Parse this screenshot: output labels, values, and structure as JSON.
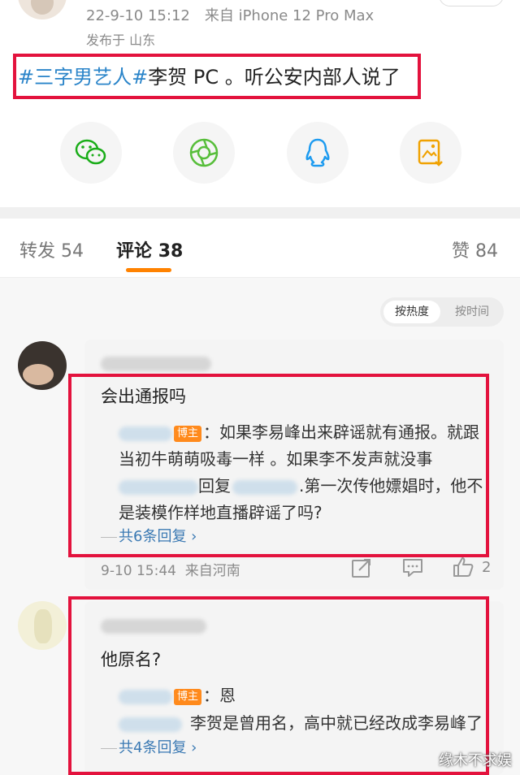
{
  "post": {
    "date": "22-9-10 15:12",
    "device": "来自 iPhone 12 Pro Max",
    "location": "发布于 山东",
    "text_tag": "#三字男艺人#",
    "text_body": "李贺 PC 。听公安内部人说了"
  },
  "share_icons": [
    "wechat-icon",
    "moments-icon",
    "qq-icon",
    "save-image-icon"
  ],
  "tabs": {
    "repost": "转发 54",
    "comments_label": "评论",
    "comments_count": "38",
    "likes": "赞 84"
  },
  "sort": {
    "hot": "按热度",
    "time": "按时间"
  },
  "comments": [
    {
      "text": "会出通报吗",
      "badge": "博主",
      "reply1_a": "：如果李易峰出来辟谣就有通报。就跟",
      "reply1_b": "当初牛萌萌吸毒一样 。如果李不发声就没事",
      "reply2_mid": "回复",
      "reply2_a": ".第一次传他嫖娼时，他不",
      "reply2_b": "是装模作样地直播辟谣了吗?",
      "more": "共6条回复 ›",
      "time": "9-10 15:44",
      "source": "来自河南",
      "likes": "2"
    },
    {
      "text": "他原名?",
      "badge": "博主",
      "reply1_a": "：恩",
      "reply2_a": "李贺是曾用名，高中就已经改成李易峰了",
      "more": "共4条回复 ›"
    }
  ],
  "watermark": "缘木不求娱",
  "colors": {
    "accent": "#ff8200",
    "link": "#2a84c9",
    "highlight_box": "#e3123d"
  }
}
